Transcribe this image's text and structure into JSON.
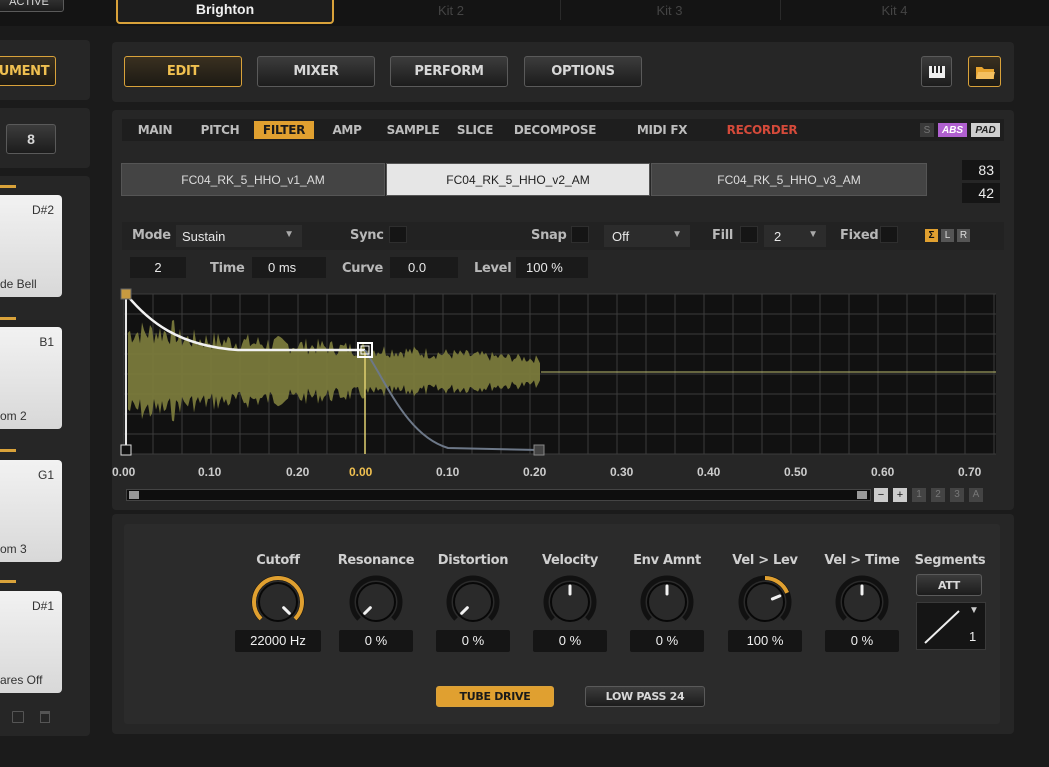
{
  "top_left": {
    "label": "ACTIVE"
  },
  "kits": [
    {
      "label": "Brighton",
      "active": true
    },
    {
      "label": "Kit 2"
    },
    {
      "label": "Kit 3"
    },
    {
      "label": "Kit 4"
    }
  ],
  "left": {
    "instrument_label": "UMENT",
    "number_value": "8",
    "pads": [
      {
        "note": "D#2",
        "name": "de Bell"
      },
      {
        "note": "B1",
        "name": "om 2"
      },
      {
        "note": "G1",
        "name": "om 3"
      },
      {
        "note": "D#1",
        "name": "ares Off"
      }
    ]
  },
  "main_nav": {
    "edit": "EDIT",
    "mixer": "MIXER",
    "perform": "PERFORM",
    "options": "OPTIONS"
  },
  "sub_tabs": {
    "main": "MAIN",
    "pitch": "PITCH",
    "filter": "FILTER",
    "amp": "AMP",
    "sample": "SAMPLE",
    "slice": "SLICE",
    "decompose": "DECOMPOSE",
    "midi_fx": "MIDI FX",
    "recorder": "RECORDER",
    "s": "S",
    "abs": "ABS",
    "pad": "PAD"
  },
  "samples": [
    "FC04_RK_5_HHO_v1_AM",
    "FC04_RK_5_HHO_v2_AM",
    "FC04_RK_5_HHO_v3_AM"
  ],
  "velocity": {
    "high": "83",
    "low": "42"
  },
  "envelope": {
    "mode_label": "Mode",
    "mode_value": "Sustain",
    "sync_label": "Sync",
    "snap_label": "Snap",
    "snap_value": "Off",
    "fill_label": "Fill",
    "fill_value": "2",
    "fixed_label": "Fixed",
    "sigma": "Σ",
    "l": "L",
    "r": "R",
    "node_value": "2",
    "time_label": "Time",
    "time_value": "0 ms",
    "curve_label": "Curve",
    "curve_value": "0.0",
    "level_label": "Level",
    "level_value": "100 %"
  },
  "ruler": [
    "0.00",
    "0.10",
    "0.20",
    "0.00",
    "0.10",
    "0.20",
    "0.30",
    "0.40",
    "0.50",
    "0.60",
    "0.70"
  ],
  "scroll": {
    "minus": "−",
    "plus": "+",
    "b1": "1",
    "b2": "2",
    "b3": "3",
    "ba": "A"
  },
  "knobs": [
    {
      "label": "Cutoff",
      "value": "22000 Hz",
      "level": 1.0
    },
    {
      "label": "Resonance",
      "value": "0 %",
      "level": 0.0
    },
    {
      "label": "Distortion",
      "value": "0 %",
      "level": 0.0
    },
    {
      "label": "Velocity",
      "value": "0 %",
      "level": 0.5
    },
    {
      "label": "Env Amnt",
      "value": "0 %",
      "level": 0.5
    },
    {
      "label": "Vel > Lev",
      "value": "100 %",
      "level": 0.75
    },
    {
      "label": "Vel > Time",
      "value": "0 %",
      "level": 0.5
    }
  ],
  "segments": {
    "label": "Segments",
    "att": "ATT",
    "count": "1"
  },
  "bottom_buttons": {
    "tube_drive": "TUBE DRIVE",
    "low_pass": "LOW PASS 24"
  },
  "colors": {
    "accent": "#d9a23a",
    "recorder": "#c0392b",
    "abs": "#b060d0",
    "waveform": "#7a7a3c"
  }
}
